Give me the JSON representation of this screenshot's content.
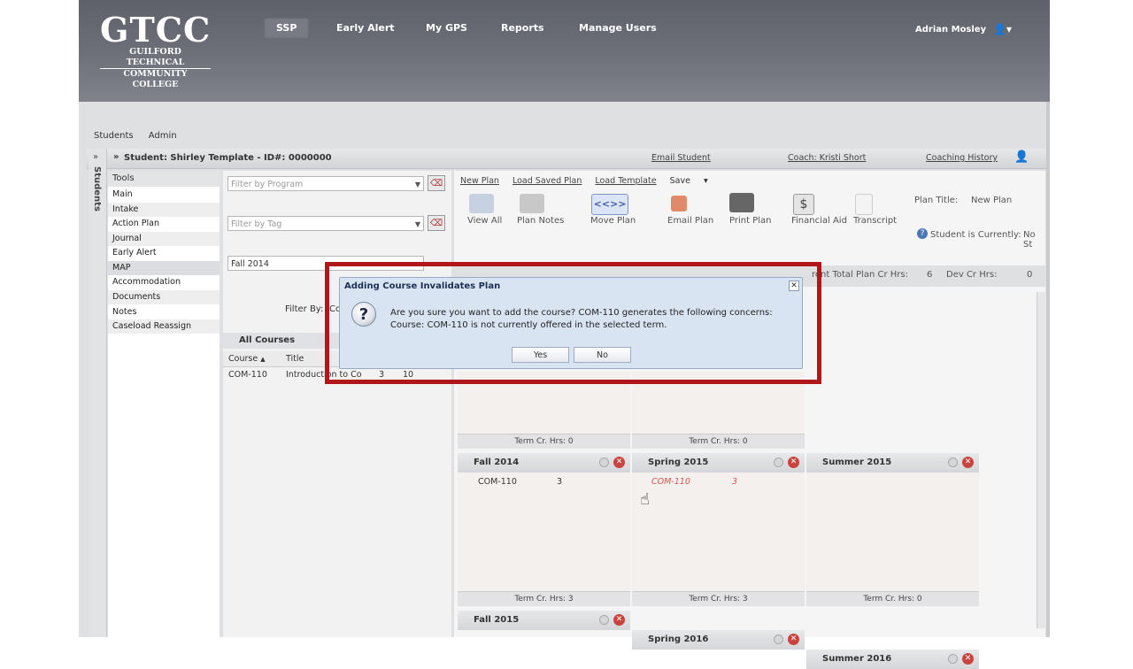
{
  "header": {
    "logo_big": "GTCC",
    "logo_line1": "GUILFORD TECHNICAL",
    "logo_line2": "COMMUNITY COLLEGE",
    "nav": [
      "SSP",
      "Early Alert",
      "My GPS",
      "Reports",
      "Manage Users"
    ],
    "active_nav": "SSP",
    "user_name": "Adrian Mosley"
  },
  "breadcrumbs": [
    "Students",
    "Admin"
  ],
  "student_bar": {
    "title": "Student: Shirley Template - ID#: 0000000",
    "email_link": "Email Student",
    "coach_link": "Coach: Kristi Short",
    "history_link": "Coaching History",
    "rail_label": "Students"
  },
  "tools": {
    "header": "Tools",
    "items": [
      "Main",
      "Intake",
      "Action Plan",
      "Journal",
      "Early Alert",
      "MAP",
      "Accommodation",
      "Documents",
      "Notes",
      "Caseload Reassign"
    ],
    "selected": "MAP"
  },
  "filters": {
    "program_placeholder": "Filter by Program",
    "tag_placeholder": "Filter by Tag",
    "term_value": "Fall 2014",
    "filter_by_label": "Filter By:",
    "filter_by_value": "Co"
  },
  "all_courses": {
    "header": "All Courses",
    "columns": [
      "Course",
      "Title"
    ],
    "rows": [
      {
        "course": "COM-110",
        "title": "Introduction to Com",
        "cr": "3",
        "extra": "10"
      }
    ]
  },
  "map": {
    "links": [
      "New Plan",
      "Load Saved Plan",
      "Load Template",
      "Save"
    ],
    "toolbar": [
      "View All",
      "Plan Notes",
      "Move Plan",
      "Email Plan",
      "Print Plan",
      "Financial Aid",
      "Transcript"
    ],
    "plan_title_label": "Plan Title:",
    "plan_title_value": "New Plan",
    "student_currently": "Student is Currently:",
    "student_currently_value": "No St",
    "total_label": "rent Total Plan Cr Hrs:",
    "total_value": "6",
    "dev_label": "Dev Cr Hrs:",
    "dev_value": "0",
    "upper_terms": [
      {
        "foot": "Term Cr. Hrs: 0"
      },
      {
        "foot": "Term Cr. Hrs: 0"
      }
    ],
    "terms": [
      {
        "name": "Fall 2014",
        "course": "COM-110",
        "hrs": "3",
        "foot": "Term Cr. Hrs: 3",
        "invalid": false
      },
      {
        "name": "Spring 2015",
        "course": "COM-110",
        "hrs": "3",
        "foot": "Term Cr. Hrs: 3",
        "invalid": true
      },
      {
        "name": "Summer 2015",
        "course": "",
        "hrs": "",
        "foot": "Term Cr. Hrs: 0",
        "invalid": false
      }
    ],
    "next_terms": [
      "Fall 2015",
      "Spring 2016",
      "Summer 2016"
    ]
  },
  "dialog": {
    "title": "Adding Course Invalidates Plan",
    "line1": "Are you sure you want to add the course? COM-110 generates the following concerns:",
    "line2": "Course: COM-110 is not currently offered in the selected term.",
    "yes": "Yes",
    "no": "No",
    "icon": "question-icon"
  },
  "colors": {
    "header_bg": "#6c6f78",
    "highlight_border": "#b0161a",
    "dialog_bg": "#d9e4f3",
    "invalid_text": "#d9534f"
  }
}
